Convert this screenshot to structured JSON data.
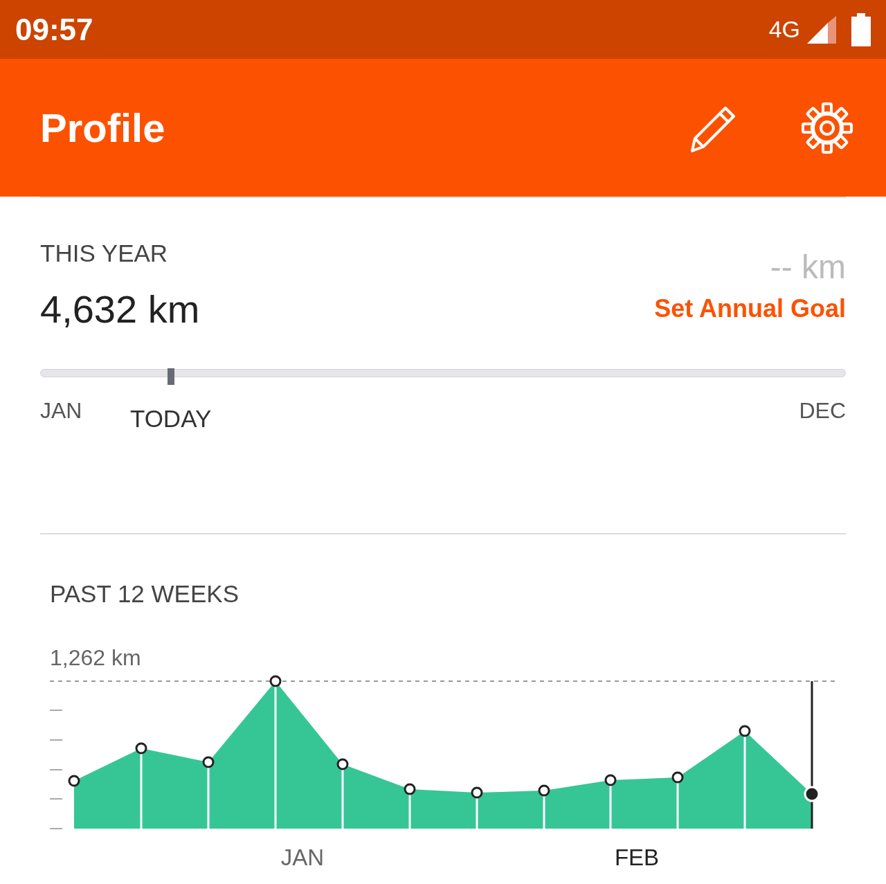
{
  "status_bar": {
    "time": "09:57",
    "network": "4G"
  },
  "app_bar": {
    "title": "Profile"
  },
  "this_year": {
    "label": "THIS YEAR",
    "distance": "4,632 km",
    "goal": "-- km",
    "goal_link": "Set Annual Goal",
    "progress": {
      "level": 0.162,
      "start": "JAN",
      "marker_label": "TODAY",
      "end": "DEC"
    }
  },
  "past_weeks": {
    "label": "PAST 12 WEEKS",
    "max_label": "1,262 km",
    "months": [
      {
        "label": "JAN",
        "selected": false
      },
      {
        "label": "FEB",
        "selected": true
      }
    ]
  }
}
